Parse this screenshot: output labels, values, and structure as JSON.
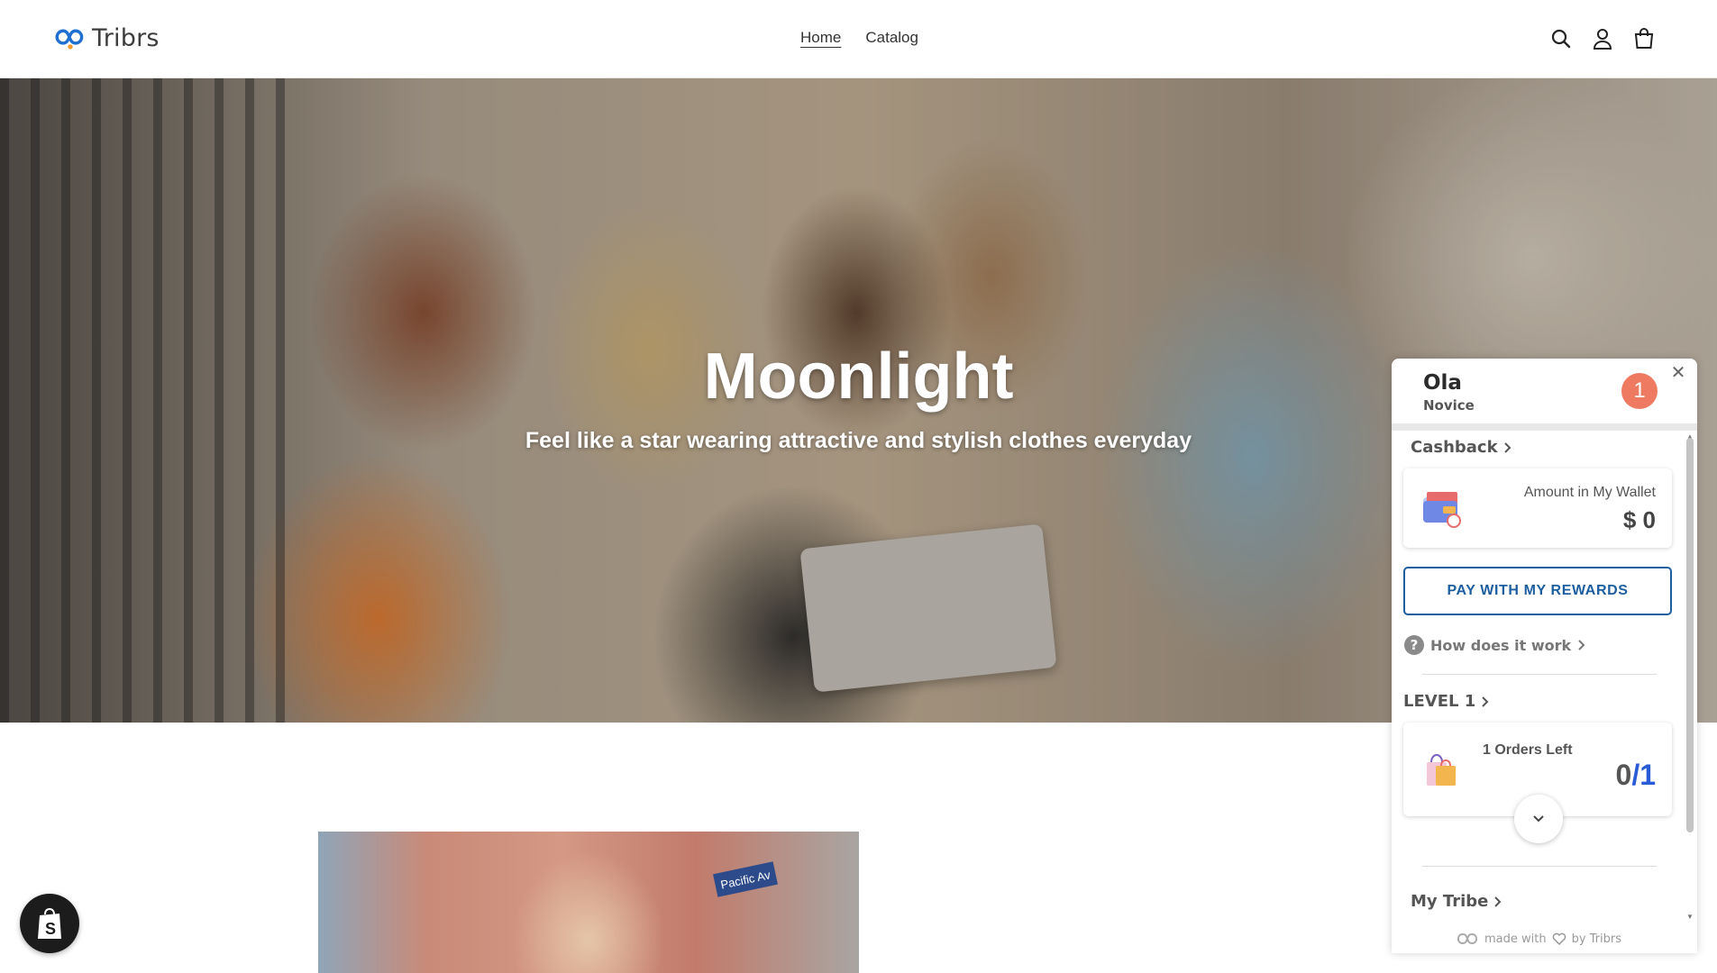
{
  "header": {
    "logo_text": "Tribrs",
    "nav": [
      {
        "label": "Home",
        "active": true
      },
      {
        "label": "Catalog",
        "active": false
      }
    ],
    "icons": [
      "search-icon",
      "account-icon",
      "cart-icon"
    ]
  },
  "hero": {
    "title": "Moonlight",
    "subtitle": "Feel like a star wearing attractive and stylish clothes everyday"
  },
  "feature": {
    "street_sign": "Pacific Av"
  },
  "widget": {
    "user_name": "Ola",
    "user_rank": "Novice",
    "notification_count": "1",
    "close_symbol": "✕",
    "cashback_title": "Cashback",
    "wallet_label": "Amount in My Wallet",
    "wallet_value": "$ 0",
    "pay_button": "PAY WITH MY REWARDS",
    "how_it_works": "How does it work",
    "level_title": "LEVEL 1",
    "orders_left_label": "1 Orders Left",
    "orders_progress": {
      "done": "0",
      "sep": "/",
      "total": "1"
    },
    "tribe_title": "My Tribe",
    "footer_made_with": "made with",
    "footer_by": "by Tribrs",
    "accent_color": "#1d5ea0",
    "badge_color": "#ee7a62"
  }
}
